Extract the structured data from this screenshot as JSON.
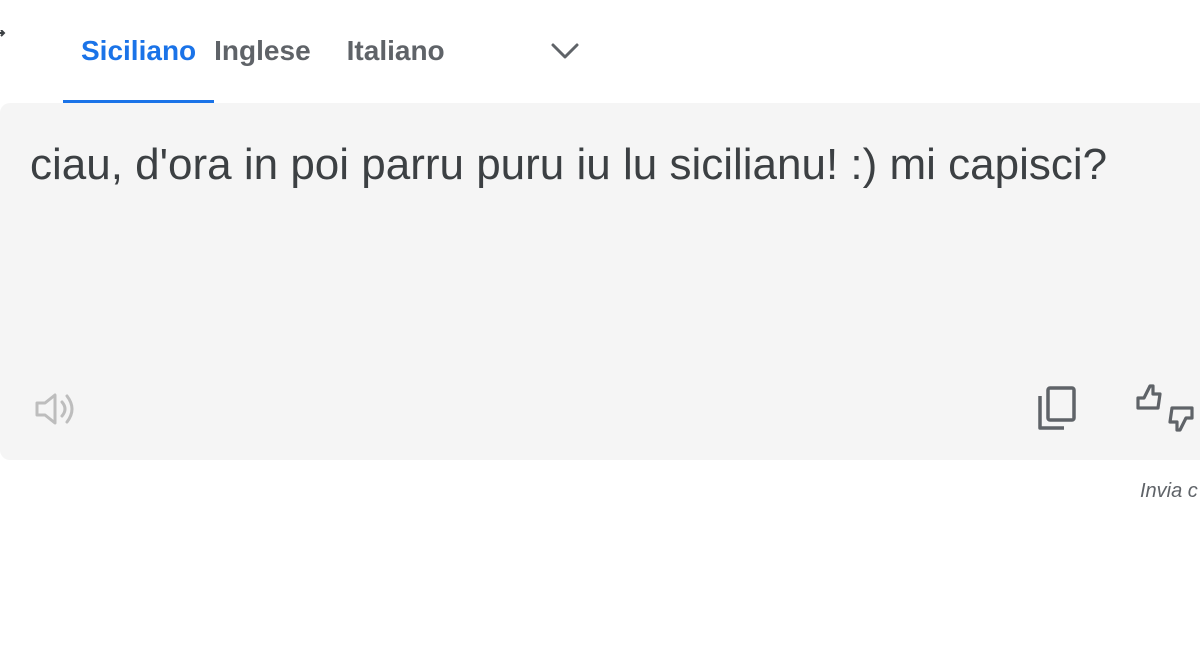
{
  "tabs": [
    {
      "label": "Siciliano",
      "active": true
    },
    {
      "label": "Inglese",
      "active": false
    },
    {
      "label": "Italiano",
      "active": false
    }
  ],
  "result": {
    "text": "ciau, d'ora in poi parru puru iu lu sicilianu! :) mi capisci?"
  },
  "icons": {
    "more_languages": "chevron-down-icon",
    "listen": "speaker-icon",
    "copy": "copy-icon",
    "rate": "thumbs-up-down-icon"
  },
  "footer": {
    "send_feedback": "Invia c"
  },
  "colors": {
    "accent": "#1a73e8",
    "text": "#3c4043",
    "muted": "#5f6368",
    "panel": "#f5f5f5"
  }
}
